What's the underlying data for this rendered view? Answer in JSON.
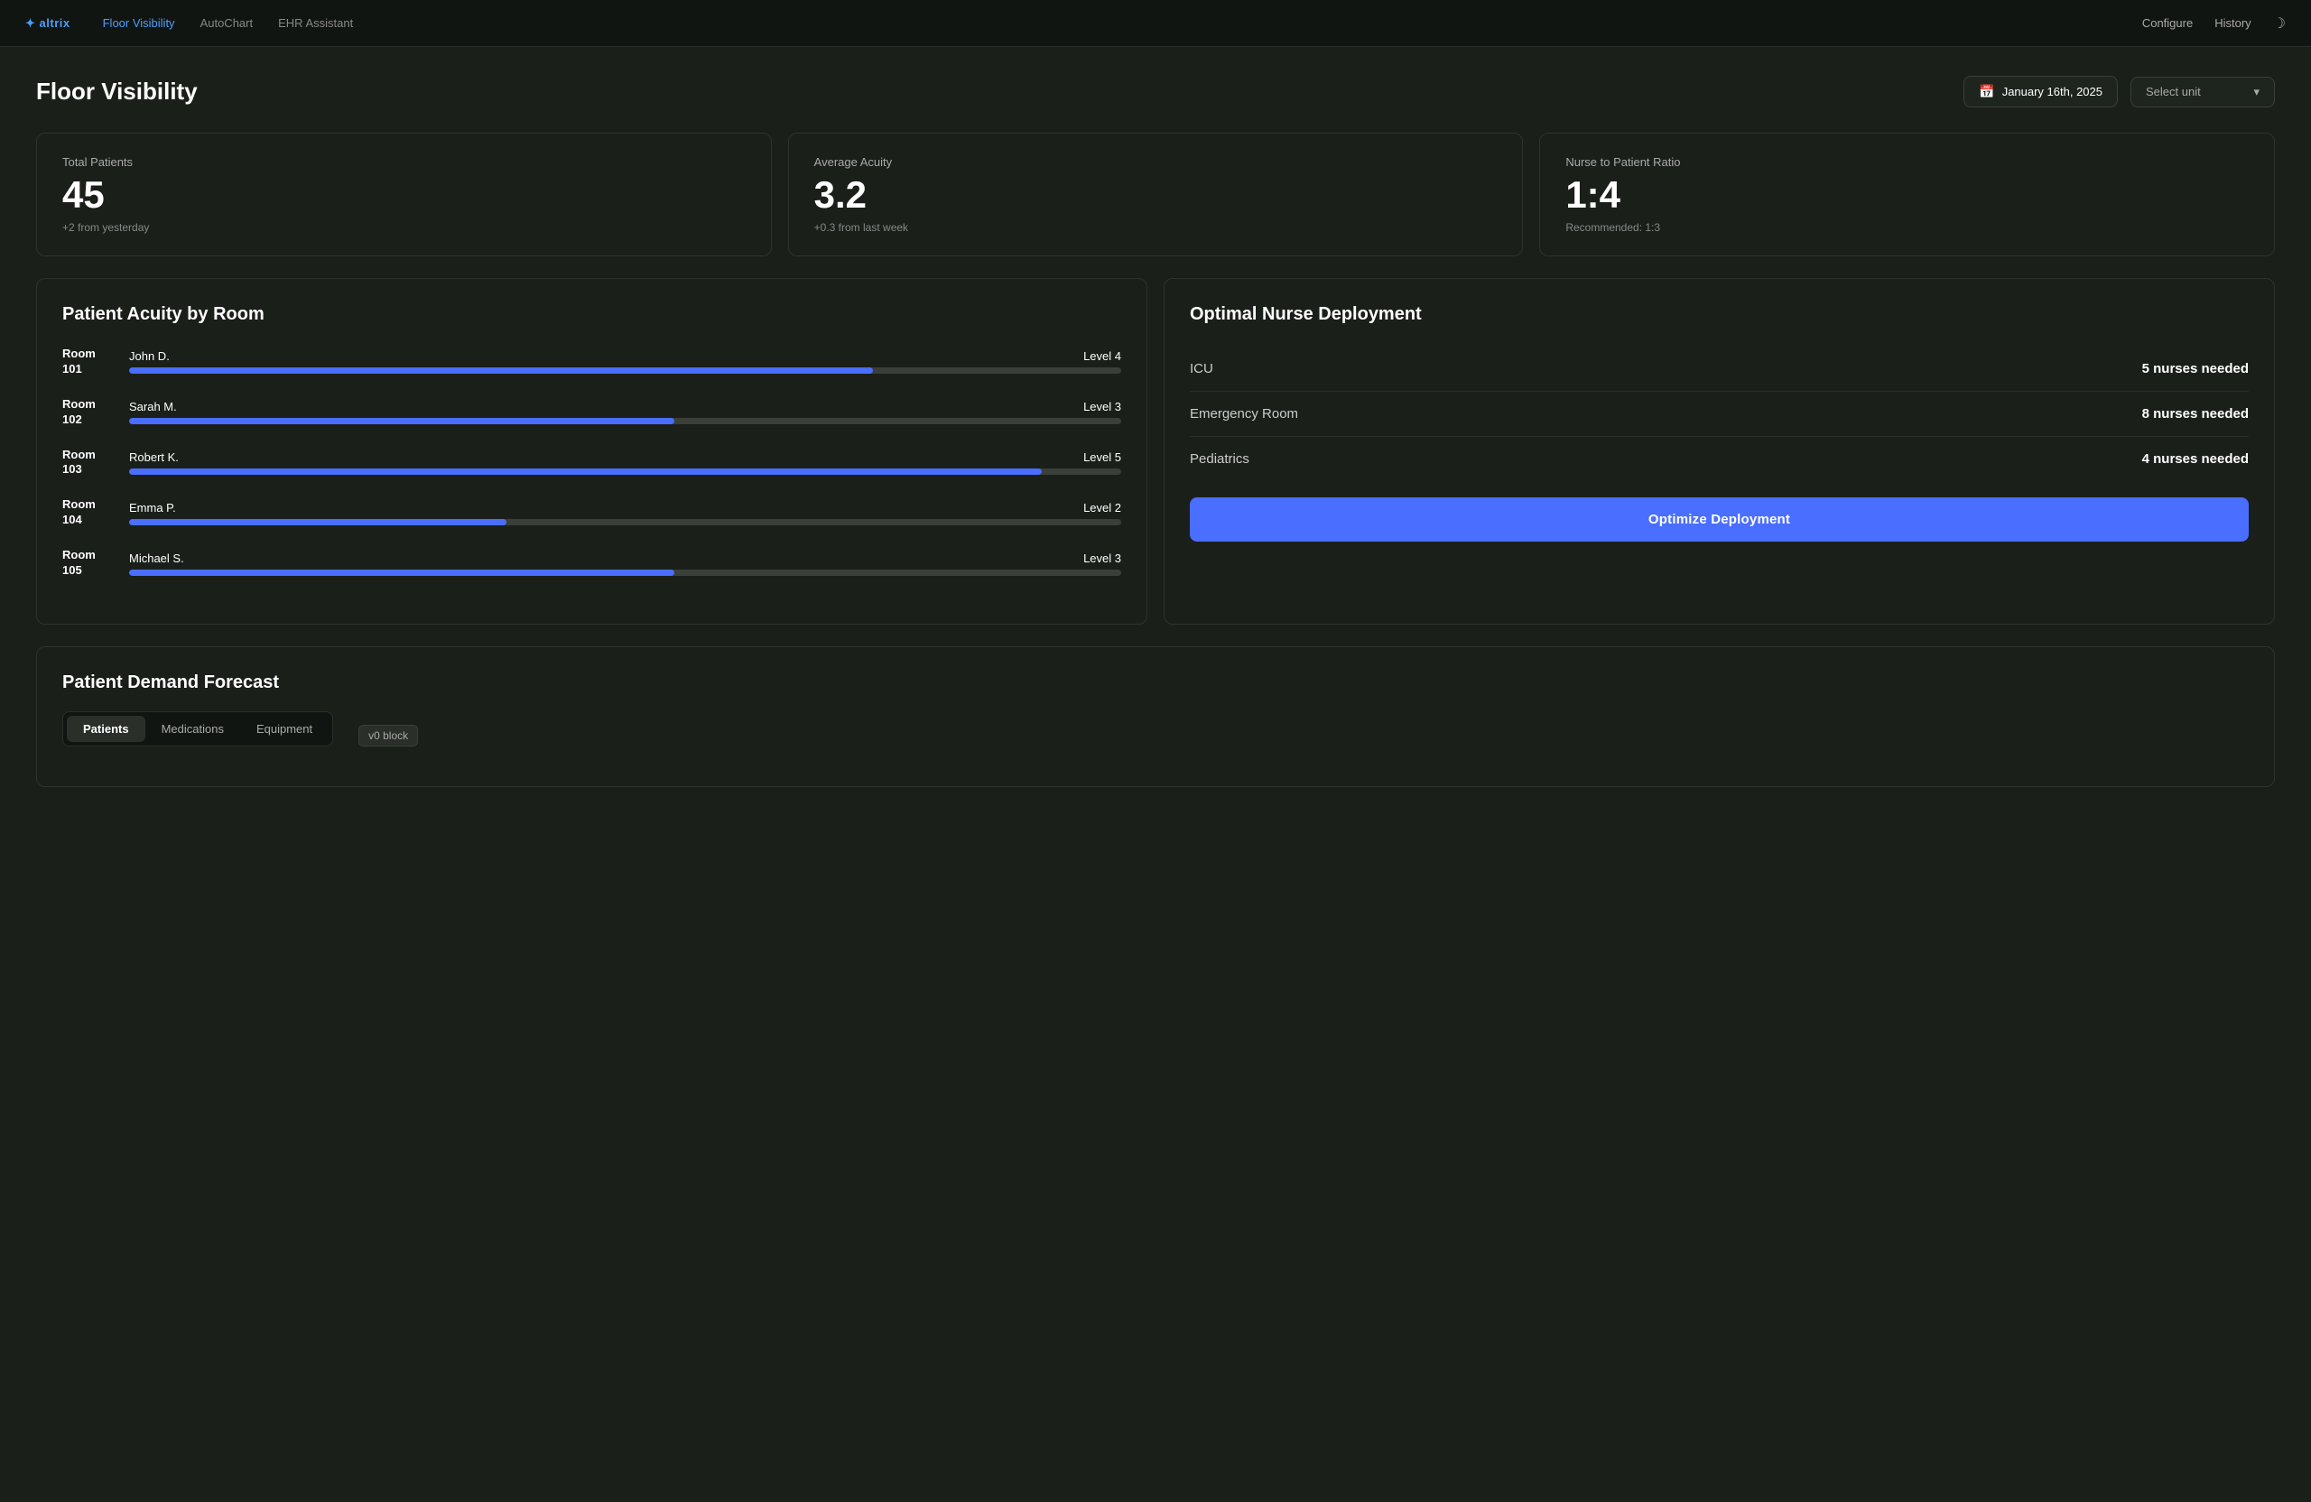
{
  "nav": {
    "logo": "altrix",
    "links": [
      {
        "label": "Floor Visibility",
        "active": true
      },
      {
        "label": "AutoChart",
        "active": false
      },
      {
        "label": "EHR Assistant",
        "active": false
      }
    ],
    "right_links": [
      {
        "label": "Configure"
      },
      {
        "label": "History"
      }
    ]
  },
  "header": {
    "title": "Floor Visibility",
    "date": "January 16th, 2025",
    "unit_placeholder": "Select unit"
  },
  "stats": [
    {
      "label": "Total Patients",
      "value": "45",
      "sub": "+2 from yesterday"
    },
    {
      "label": "Average Acuity",
      "value": "3.2",
      "sub": "+0.3 from last week"
    },
    {
      "label": "Nurse to Patient Ratio",
      "value": "1:4",
      "sub": "Recommended: 1:3"
    }
  ],
  "acuity": {
    "title": "Patient Acuity by Room",
    "rooms": [
      {
        "room": "Room 101",
        "patient": "John D.",
        "level": "Level 4",
        "progress": 75
      },
      {
        "room": "Room 102",
        "patient": "Sarah M.",
        "level": "Level 3",
        "progress": 55
      },
      {
        "room": "Room 103",
        "patient": "Robert K.",
        "level": "Level 5",
        "progress": 92
      },
      {
        "room": "Room 104",
        "patient": "Emma P.",
        "level": "Level 2",
        "progress": 38
      },
      {
        "room": "Room 105",
        "patient": "Michael S.",
        "level": "Level 3",
        "progress": 55
      }
    ]
  },
  "deployment": {
    "title": "Optimal Nurse Deployment",
    "units": [
      {
        "name": "ICU",
        "count": "5 nurses needed"
      },
      {
        "name": "Emergency Room",
        "count": "8 nurses needed"
      },
      {
        "name": "Pediatrics",
        "count": "4 nurses needed"
      }
    ],
    "button_label": "Optimize Deployment"
  },
  "forecast": {
    "title": "Patient Demand Forecast",
    "tabs": [
      {
        "label": "Patients",
        "active": true
      },
      {
        "label": "Medications",
        "active": false
      },
      {
        "label": "Equipment",
        "active": false
      }
    ],
    "badge": "v0 block"
  }
}
